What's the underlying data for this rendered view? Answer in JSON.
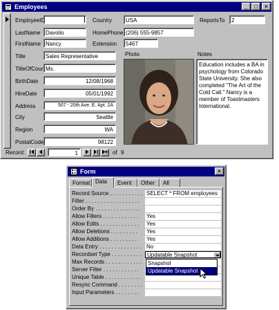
{
  "employees_window": {
    "title": "Employees",
    "buttons": {
      "minimize": "_",
      "maximize": "□",
      "close": "×"
    },
    "fields": {
      "employee_id": {
        "label": "EmployeeID",
        "value": ""
      },
      "last_name": {
        "label": "LastName",
        "value": "Davolio"
      },
      "first_name": {
        "label": "FirstName",
        "value": "Nancy"
      },
      "title": {
        "label": "Title",
        "value": "Sales Representative"
      },
      "title_of_courtesy": {
        "label": "TitleOfCourt",
        "value": "Ms."
      },
      "birth_date": {
        "label": "BirthDate",
        "value": "12/08/1968"
      },
      "hire_date": {
        "label": "HireDate",
        "value": "05/01/1992"
      },
      "address": {
        "label": "Address",
        "value": "507 - 20th Ave. E. Apt. 2A"
      },
      "city": {
        "label": "City",
        "value": "Seattle"
      },
      "region": {
        "label": "Region",
        "value": "WA"
      },
      "postal_code": {
        "label": "PostalCode",
        "value": "98122"
      },
      "country": {
        "label": "Country",
        "value": "USA"
      },
      "home_phone": {
        "label": "HomePhone",
        "value": "(206) 555-9857"
      },
      "extension": {
        "label": "Extension",
        "value": "5467"
      },
      "reports_to": {
        "label": "ReportsTo",
        "value": "2"
      },
      "photo": {
        "label": "Photo"
      },
      "notes": {
        "label": "Notes",
        "value": "Education includes a BA in psychology from Colorado State University.  She also completed \"The Art of the Cold Call.\"  Nancy is a member of Toastmasters International."
      }
    },
    "navigation": {
      "label": "Record:",
      "current": "1",
      "of_label": "of",
      "total": "9"
    }
  },
  "form_dialog": {
    "title": "Form",
    "close_button": "×",
    "tabs": [
      {
        "label": "Format",
        "active": false
      },
      {
        "label": "Data",
        "active": true
      },
      {
        "label": "Event",
        "active": false
      },
      {
        "label": "Other",
        "active": false
      },
      {
        "label": "All",
        "active": false
      }
    ],
    "properties": [
      {
        "label": "Record Source . . . . . . . . . . .",
        "value": "SELECT * FROM employees"
      },
      {
        "label": "Filter . . . . . . . . . . . . . . . . . .",
        "value": ""
      },
      {
        "label": "Order By . . . . . . . . . . . . . . .",
        "value": ""
      },
      {
        "label": "Allow Filters . . . . . . . . . . . .",
        "value": "Yes"
      },
      {
        "label": "Allow Edits . . . . . . . . . . . . .",
        "value": "Yes"
      },
      {
        "label": "Allow Deletions . . . . . . . . .",
        "value": "Yes"
      },
      {
        "label": "Allow Additions . . . . . . . . .",
        "value": "Yes"
      },
      {
        "label": "Data Entry . . . . . . . . . . . . . .",
        "value": "No"
      },
      {
        "label": "Recordset Type . . . . . . . . . .",
        "value": "Updatable Snapshot"
      },
      {
        "label": "Max Records . . . . . . . . . . . .",
        "value": ""
      },
      {
        "label": "Server Filter . . . . . . . . . . . .",
        "value": ""
      },
      {
        "label": "Unique Table . . . . . . . . . . . .",
        "value": ""
      },
      {
        "label": "Resync Command . . . . . . . .",
        "value": ""
      },
      {
        "label": "Input Parameters . . . . . . . .",
        "value": ""
      }
    ],
    "recordset_dropdown_options": [
      {
        "label": "Snapshot",
        "selected": false
      },
      {
        "label": "Updatable Snapshot",
        "selected": true
      }
    ]
  }
}
